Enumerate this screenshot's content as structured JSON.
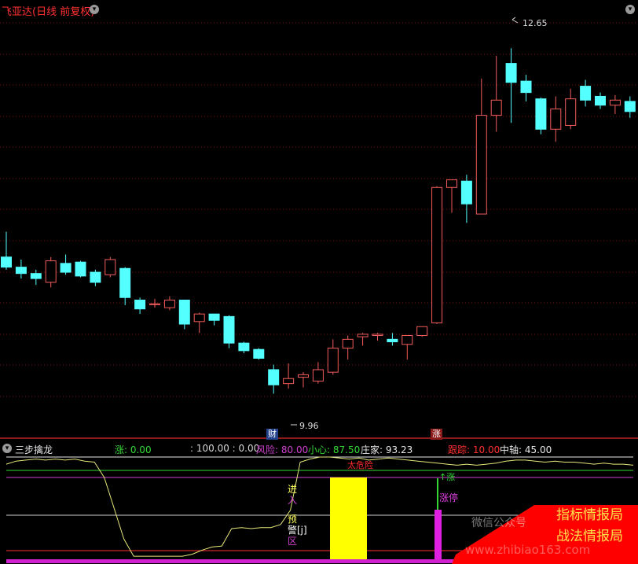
{
  "header": {
    "title": "飞亚达(日线 前复权)",
    "menu_icon": "chevron-down-icon",
    "close_icon": "chevron-down-icon"
  },
  "price_chart": {
    "high_label": "12.65",
    "low_label": "9.96",
    "marker_cai": "财",
    "marker_zhang": "涨",
    "y_min": 9.6,
    "y_max": 13.0,
    "up_color": "#f25c5c",
    "down_color": "#54ffff",
    "candles": [
      [
        11.0,
        11.2,
        10.9,
        10.92
      ],
      [
        10.92,
        10.98,
        10.83,
        10.87
      ],
      [
        10.87,
        10.9,
        10.78,
        10.83
      ],
      [
        10.8,
        11.0,
        10.76,
        10.97
      ],
      [
        10.95,
        11.02,
        10.86,
        10.88
      ],
      [
        10.96,
        10.97,
        10.84,
        10.85
      ],
      [
        10.88,
        10.9,
        10.77,
        10.8
      ],
      [
        10.86,
        11.0,
        10.84,
        10.98
      ],
      [
        10.91,
        10.92,
        10.62,
        10.68
      ],
      [
        10.66,
        10.68,
        10.55,
        10.59
      ],
      [
        10.63,
        10.67,
        10.6,
        10.63
      ],
      [
        10.6,
        10.69,
        10.58,
        10.66
      ],
      [
        10.66,
        10.66,
        10.43,
        10.47
      ],
      [
        10.49,
        10.56,
        10.4,
        10.55
      ],
      [
        10.55,
        10.55,
        10.46,
        10.5
      ],
      [
        10.53,
        10.54,
        10.28,
        10.32
      ],
      [
        10.32,
        10.33,
        10.24,
        10.26
      ],
      [
        10.27,
        10.28,
        10.19,
        10.2
      ],
      [
        10.11,
        10.15,
        9.92,
        9.99
      ],
      [
        10.0,
        10.16,
        9.96,
        10.04
      ],
      [
        10.05,
        10.09,
        9.97,
        10.07
      ],
      [
        10.02,
        10.17,
        10.0,
        10.11
      ],
      [
        10.09,
        10.35,
        10.07,
        10.28
      ],
      [
        10.28,
        10.38,
        10.19,
        10.35
      ],
      [
        10.37,
        10.4,
        10.3,
        10.39
      ],
      [
        10.38,
        10.4,
        10.34,
        10.39
      ],
      [
        10.35,
        10.4,
        10.3,
        10.33
      ],
      [
        10.31,
        10.37,
        10.19,
        10.38
      ],
      [
        10.38,
        10.45,
        10.37,
        10.45
      ],
      [
        10.48,
        11.56,
        10.47,
        11.55
      ],
      [
        11.55,
        11.6,
        11.35,
        11.61
      ],
      [
        11.6,
        11.65,
        11.27,
        11.42
      ],
      [
        11.34,
        12.41,
        11.34,
        12.12
      ],
      [
        12.12,
        12.59,
        11.99,
        12.24
      ],
      [
        12.53,
        12.65,
        12.06,
        12.38
      ],
      [
        12.39,
        12.44,
        12.23,
        12.3
      ],
      [
        12.25,
        12.26,
        11.97,
        12.01
      ],
      [
        12.01,
        12.27,
        11.91,
        12.17
      ],
      [
        12.04,
        12.33,
        12.01,
        12.25
      ],
      [
        12.35,
        12.4,
        12.19,
        12.24
      ],
      [
        12.27,
        12.3,
        12.17,
        12.2
      ],
      [
        12.2,
        12.28,
        12.13,
        12.24
      ],
      [
        12.23,
        12.27,
        12.1,
        12.15
      ]
    ]
  },
  "indicator": {
    "name": "三步擒龙",
    "params": [
      {
        "text": "涨: 0.00",
        "color": "#34d834"
      },
      {
        "text": ": 100.00 : 0.00",
        "color": "#d8d8d8"
      },
      {
        "text": "风险: 80.00",
        "color": "#d040d0"
      },
      {
        "text": "小心: 87.50",
        "color": "#34d834"
      },
      {
        "text": "庄家: 93.23",
        "color": "#e8e8e8"
      },
      {
        "text": "跟踪: 10.00",
        "color": "#ff3030"
      },
      {
        "text": "中轴: 45.00",
        "color": "#e8e8e8"
      }
    ],
    "danger_label": "太危险",
    "entry_label_1": "进",
    "entry_label_2": "入",
    "warn_label_1": "预",
    "warn_label_2": "警[j]",
    "warn_label_3": "区",
    "limit_up_label_1": "↑涨",
    "limit_up_label_2": "涨停",
    "tracking_line": [
      93,
      96,
      97,
      98,
      97,
      98,
      97,
      98,
      96,
      95,
      80,
      50,
      20,
      3,
      3,
      3,
      3,
      3,
      3,
      5,
      9,
      12,
      13,
      30,
      31,
      30,
      31,
      31,
      34,
      48,
      95,
      98,
      100,
      100,
      99,
      98,
      99,
      97,
      98,
      99,
      98,
      97,
      96,
      95,
      94,
      93,
      92,
      93,
      92,
      93,
      94,
      96,
      97,
      97,
      96,
      95,
      96,
      95,
      95,
      94,
      93,
      94,
      93,
      93,
      92
    ]
  },
  "watermark": {
    "line1": "指标情报局",
    "line2": "战法情报局",
    "line3": "微信公众号",
    "line4": "www.zhibiao163.com"
  }
}
